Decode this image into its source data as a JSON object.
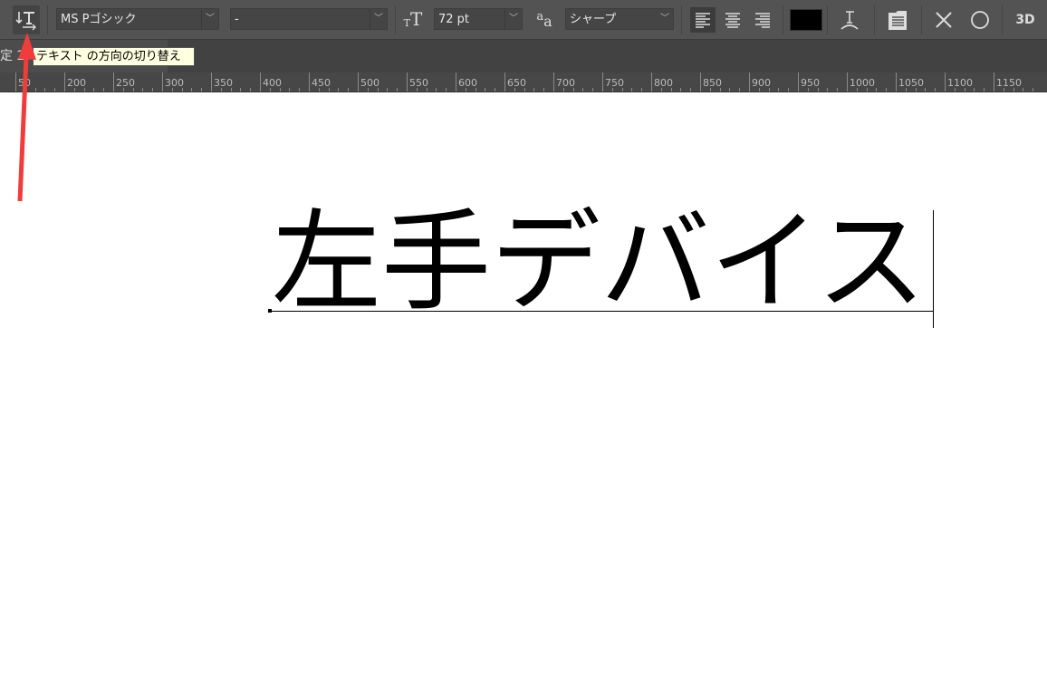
{
  "toolbar": {
    "font_family": "MS Pゴシック",
    "font_style": "-",
    "font_size": "72 pt",
    "antialias": "シャープ",
    "text_color": "#000000"
  },
  "tab": {
    "label": "定 2"
  },
  "tooltip": {
    "text": "テキスト の方向の切り替え"
  },
  "ruler": {
    "labels": [
      "50",
      "200",
      "250",
      "300",
      "350",
      "400",
      "450",
      "500",
      "550",
      "600",
      "650",
      "700",
      "750",
      "800",
      "850",
      "900",
      "950",
      "1000",
      "1050",
      "1100",
      "1150"
    ]
  },
  "canvas": {
    "text": "左手デバイス"
  },
  "annotation": {
    "arrow_color": "#f03c3c"
  }
}
